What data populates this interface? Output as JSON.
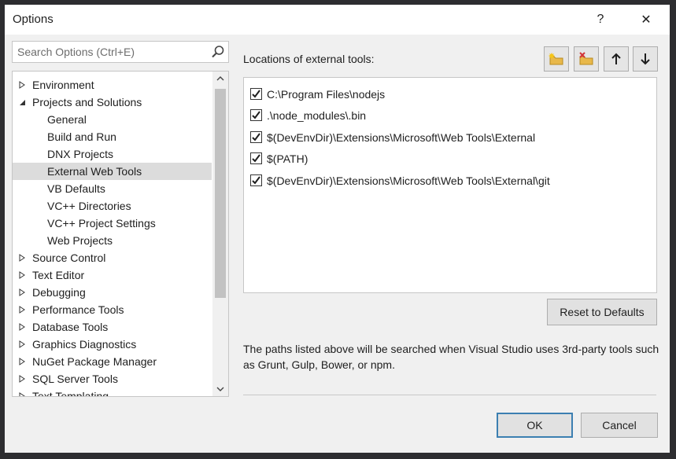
{
  "window": {
    "title": "Options",
    "help_glyph": "?",
    "close_glyph": "✕"
  },
  "search": {
    "placeholder": "Search Options (Ctrl+E)"
  },
  "tree": {
    "items": [
      {
        "label": "Environment",
        "expander": "collapsed",
        "level": 0
      },
      {
        "label": "Projects and Solutions",
        "expander": "expanded",
        "level": 0
      },
      {
        "label": "General",
        "expander": "none",
        "level": 1
      },
      {
        "label": "Build and Run",
        "expander": "none",
        "level": 1
      },
      {
        "label": "DNX Projects",
        "expander": "none",
        "level": 1
      },
      {
        "label": "External Web Tools",
        "expander": "none",
        "level": 1,
        "selected": true
      },
      {
        "label": "VB Defaults",
        "expander": "none",
        "level": 1
      },
      {
        "label": "VC++ Directories",
        "expander": "none",
        "level": 1
      },
      {
        "label": "VC++ Project Settings",
        "expander": "none",
        "level": 1
      },
      {
        "label": "Web Projects",
        "expander": "none",
        "level": 1
      },
      {
        "label": "Source Control",
        "expander": "collapsed",
        "level": 0
      },
      {
        "label": "Text Editor",
        "expander": "collapsed",
        "level": 0
      },
      {
        "label": "Debugging",
        "expander": "collapsed",
        "level": 0
      },
      {
        "label": "Performance Tools",
        "expander": "collapsed",
        "level": 0
      },
      {
        "label": "Database Tools",
        "expander": "collapsed",
        "level": 0
      },
      {
        "label": "Graphics Diagnostics",
        "expander": "collapsed",
        "level": 0
      },
      {
        "label": "NuGet Package Manager",
        "expander": "collapsed",
        "level": 0
      },
      {
        "label": "SQL Server Tools",
        "expander": "collapsed",
        "level": 0
      },
      {
        "label": "Text Templating",
        "expander": "collapsed",
        "level": 0
      }
    ]
  },
  "external_tools": {
    "label": "Locations of external tools:",
    "toolbar": [
      {
        "name": "new-folder-button",
        "icon": "new-folder-icon"
      },
      {
        "name": "remove-folder-button",
        "icon": "remove-folder-icon"
      },
      {
        "name": "move-up-button",
        "icon": "arrow-up-icon"
      },
      {
        "name": "move-down-button",
        "icon": "arrow-down-icon"
      }
    ],
    "paths": [
      {
        "text": "C:\\Program Files\\nodejs",
        "checked": true
      },
      {
        "text": ".\\node_modules\\.bin",
        "checked": true
      },
      {
        "text": "$(DevEnvDir)\\Extensions\\Microsoft\\Web Tools\\External",
        "checked": true
      },
      {
        "text": "$(PATH)",
        "checked": true
      },
      {
        "text": "$(DevEnvDir)\\Extensions\\Microsoft\\Web Tools\\External\\git",
        "checked": true
      }
    ],
    "reset_label": "Reset to Defaults",
    "description": "The paths listed above will be searched when Visual Studio uses 3rd-party tools such as Grunt, Gulp, Bower, or npm."
  },
  "footer": {
    "ok_label": "OK",
    "cancel_label": "Cancel"
  },
  "colors": {
    "selection": "#dcdcdc",
    "ok_border": "#3c7fb1",
    "folder": "#e8b84a",
    "remove_x": "#d13438"
  }
}
